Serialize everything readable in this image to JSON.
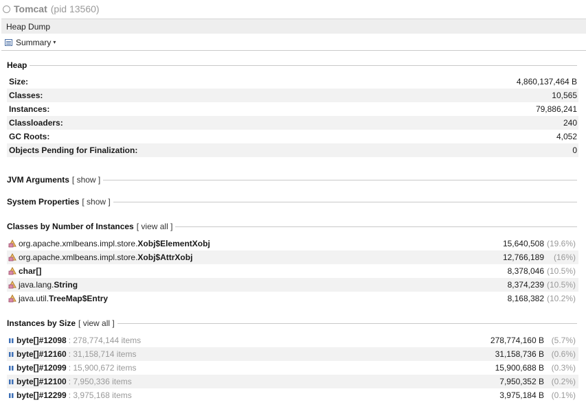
{
  "window": {
    "title": "Tomcat",
    "pid": "(pid 13560)"
  },
  "tab": {
    "label": "Heap Dump"
  },
  "view": {
    "label": "Summary",
    "caret": "▾"
  },
  "heap": {
    "title": "Heap",
    "rows": [
      {
        "label": "Size:",
        "value": "4,860,137,464 B"
      },
      {
        "label": "Classes:",
        "value": "10,565"
      },
      {
        "label": "Instances:",
        "value": "79,886,241"
      },
      {
        "label": "Classloaders:",
        "value": "240"
      },
      {
        "label": "GC Roots:",
        "value": "4,052"
      },
      {
        "label": "Objects Pending for Finalization:",
        "value": "0"
      }
    ]
  },
  "jvm_arguments": {
    "title": "JVM Arguments",
    "link": "[ show ]"
  },
  "system_properties": {
    "title": "System Properties",
    "link": "[ show ]"
  },
  "classes_by_instances": {
    "title": "Classes by Number of Instances",
    "link": "[ view all ]",
    "rows": [
      {
        "pkg": "org.apache.xmlbeans.impl.store.",
        "name": "Xobj$ElementXobj",
        "count": "15,640,508",
        "pct": "(19.6%)"
      },
      {
        "pkg": "org.apache.xmlbeans.impl.store.",
        "name": "Xobj$AttrXobj",
        "count": "12,766,189",
        "pct": "(16%)"
      },
      {
        "pkg": "",
        "name": "char[]",
        "count": "8,378,046",
        "pct": "(10.5%)"
      },
      {
        "pkg": "java.lang.",
        "name": "String",
        "count": "8,374,239",
        "pct": "(10.5%)"
      },
      {
        "pkg": "java.util.",
        "name": "TreeMap$Entry",
        "count": "8,168,382",
        "pct": "(10.2%)"
      }
    ]
  },
  "instances_by_size": {
    "title": "Instances by Size",
    "link": "[ view all ]",
    "rows": [
      {
        "name": "byte[]#12098",
        "items": ": 278,774,144 items",
        "size": "278,774,160 B",
        "pct": "(5.7%)"
      },
      {
        "name": "byte[]#12160",
        "items": ": 31,158,714 items",
        "size": "31,158,736 B",
        "pct": "(0.6%)"
      },
      {
        "name": "byte[]#12099",
        "items": ": 15,900,672 items",
        "size": "15,900,688 B",
        "pct": "(0.3%)"
      },
      {
        "name": "byte[]#12100",
        "items": ": 7,950,336 items",
        "size": "7,950,352 B",
        "pct": "(0.2%)"
      },
      {
        "name": "byte[]#12299",
        "items": ": 3,975,168 items",
        "size": "3,975,184 B",
        "pct": "(0.1%)"
      }
    ]
  }
}
